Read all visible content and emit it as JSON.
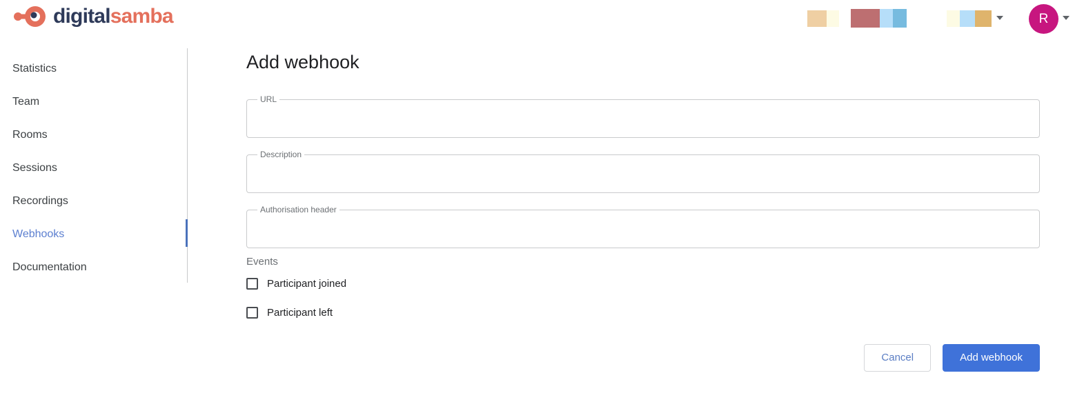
{
  "header": {
    "logo": {
      "icon": "digitalsamba-circle-logo-icon",
      "text_primary": "digital",
      "text_secondary": "samba",
      "color_primary": "#2e3a59",
      "color_secondary": "#e4705c"
    },
    "swatch_group_1": [
      "#efcfa3",
      "#fdfbe4"
    ],
    "swatch_group_2": [
      "#bd6f71",
      "#b6def9",
      "#77bbdf"
    ],
    "swatch_group_3": [
      "#fdfbe4",
      "#b6def9",
      "#dfb46c"
    ],
    "menu_chevron": "chevron-down-icon",
    "avatar": {
      "initial": "R",
      "color": "#c7167f"
    },
    "avatar_chevron": "chevron-down-icon"
  },
  "sidebar": {
    "items": [
      {
        "label": "Statistics",
        "active": false
      },
      {
        "label": "Team",
        "active": false
      },
      {
        "label": "Rooms",
        "active": false
      },
      {
        "label": "Sessions",
        "active": false
      },
      {
        "label": "Recordings",
        "active": false
      },
      {
        "label": "Webhooks",
        "active": true
      },
      {
        "label": "Documentation",
        "active": false
      }
    ],
    "active_color": "#5c7fd0",
    "active_bar_color": "#4a72bb"
  },
  "main": {
    "title": "Add webhook",
    "fields": [
      {
        "label": "URL",
        "value": "",
        "placeholder": ""
      },
      {
        "label": "Description",
        "value": "",
        "placeholder": ""
      },
      {
        "label": "Authorisation header",
        "value": "",
        "placeholder": ""
      }
    ],
    "events": {
      "label": "Events",
      "options": [
        {
          "label": "Participant joined",
          "checked": false
        },
        {
          "label": "Participant left",
          "checked": false
        }
      ]
    },
    "actions": {
      "cancel_label": "Cancel",
      "submit_label": "Add webhook",
      "submit_color": "#3f72d9"
    }
  }
}
